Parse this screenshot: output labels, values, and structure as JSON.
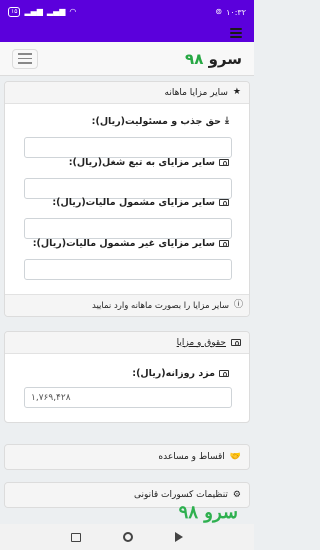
{
  "status_bar": {
    "time": "۱۰:۳۲",
    "battery": "۱۵",
    "icons": [
      "alarm-icon",
      "wifi-icon",
      "signal-icon",
      "signal-icon",
      "battery-icon"
    ]
  },
  "header": {
    "brand_text": "سرو",
    "brand_number": "۹۸"
  },
  "monthly_benefits": {
    "title": "سایر مزایا ماهانه",
    "fields": [
      {
        "label": "حق جذب و مسئولیت(ریال):",
        "value": "",
        "icon": "download-icon"
      },
      {
        "label": "سایر مزایای به تبع شغل(ریال):",
        "value": "",
        "icon": "cash-icon"
      },
      {
        "label": "سایر مزایای مشمول مالیات(ریال):",
        "value": "",
        "icon": "cash-icon"
      },
      {
        "label": "سایر مزایای غیر مشمول مالیات(ریال):",
        "value": "",
        "icon": "cash-icon"
      }
    ],
    "note": "سایر مزایا را بصورت ماهانه وارد نمایید"
  },
  "wages": {
    "title": "حقوق و مزایا",
    "field_label": "مزد روزانه(ریال):",
    "field_value": "۱,۷۶۹,۴۲۸"
  },
  "installments": {
    "title": "اقساط و مساعده"
  },
  "legal_deductions": {
    "title": "تنظیمات کسورات قانونی"
  },
  "watermark": "سرو ۹۸"
}
